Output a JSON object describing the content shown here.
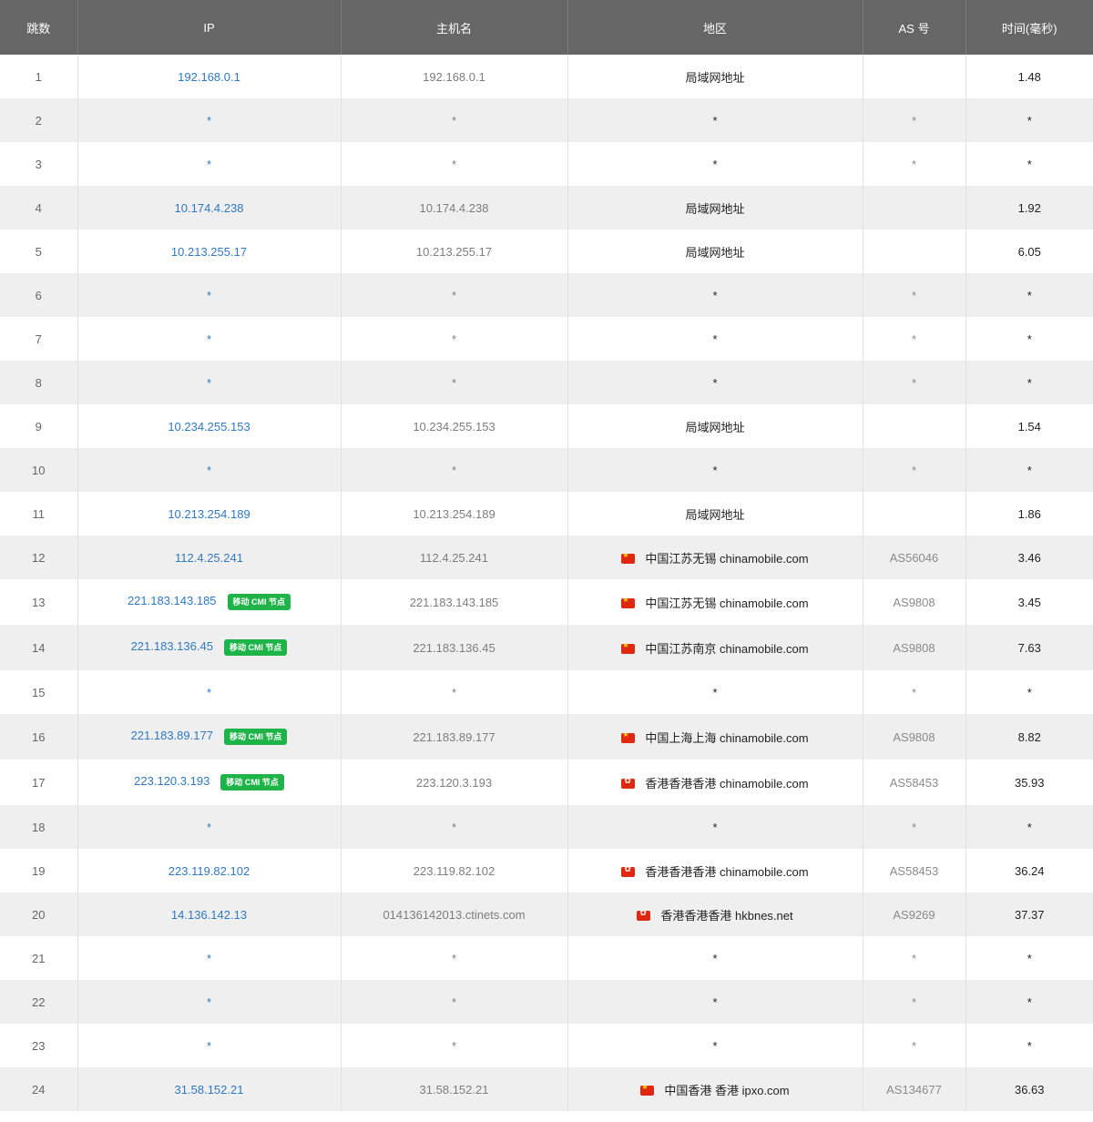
{
  "headers": {
    "hop": "跳数",
    "ip": "IP",
    "host": "主机名",
    "region": "地区",
    "as": "AS 号",
    "time": "时间(毫秒)"
  },
  "colors": {
    "header_bg": "#666666",
    "ip_link": "#2f79c4",
    "badge_bg": "#1fb44a",
    "row_alt": "#efefef"
  },
  "rows": [
    {
      "hop": "1",
      "ip": "192.168.0.1",
      "host": "192.168.0.1",
      "region": "局域网地址",
      "as": "",
      "time": "1.48",
      "flag": "",
      "badge": ""
    },
    {
      "hop": "2",
      "ip": "*",
      "host": "*",
      "region": "*",
      "as": "*",
      "time": "*",
      "flag": "",
      "badge": ""
    },
    {
      "hop": "3",
      "ip": "*",
      "host": "*",
      "region": "*",
      "as": "*",
      "time": "*",
      "flag": "",
      "badge": ""
    },
    {
      "hop": "4",
      "ip": "10.174.4.238",
      "host": "10.174.4.238",
      "region": "局域网地址",
      "as": "",
      "time": "1.92",
      "flag": "",
      "badge": ""
    },
    {
      "hop": "5",
      "ip": "10.213.255.17",
      "host": "10.213.255.17",
      "region": "局域网地址",
      "as": "",
      "time": "6.05",
      "flag": "",
      "badge": ""
    },
    {
      "hop": "6",
      "ip": "*",
      "host": "*",
      "region": "*",
      "as": "*",
      "time": "*",
      "flag": "",
      "badge": ""
    },
    {
      "hop": "7",
      "ip": "*",
      "host": "*",
      "region": "*",
      "as": "*",
      "time": "*",
      "flag": "",
      "badge": ""
    },
    {
      "hop": "8",
      "ip": "*",
      "host": "*",
      "region": "*",
      "as": "*",
      "time": "*",
      "flag": "",
      "badge": ""
    },
    {
      "hop": "9",
      "ip": "10.234.255.153",
      "host": "10.234.255.153",
      "region": "局域网地址",
      "as": "",
      "time": "1.54",
      "flag": "",
      "badge": ""
    },
    {
      "hop": "10",
      "ip": "*",
      "host": "*",
      "region": "*",
      "as": "*",
      "time": "*",
      "flag": "",
      "badge": ""
    },
    {
      "hop": "11",
      "ip": "10.213.254.189",
      "host": "10.213.254.189",
      "region": "局域网地址",
      "as": "",
      "time": "1.86",
      "flag": "",
      "badge": ""
    },
    {
      "hop": "12",
      "ip": "112.4.25.241",
      "host": "112.4.25.241",
      "region": "中国江苏无锡 chinamobile.com",
      "as": "AS56046",
      "time": "3.46",
      "flag": "cn",
      "badge": ""
    },
    {
      "hop": "13",
      "ip": "221.183.143.185",
      "host": "221.183.143.185",
      "region": "中国江苏无锡 chinamobile.com",
      "as": "AS9808",
      "time": "3.45",
      "flag": "cn",
      "badge": "移动 CMI 节点"
    },
    {
      "hop": "14",
      "ip": "221.183.136.45",
      "host": "221.183.136.45",
      "region": "中国江苏南京 chinamobile.com",
      "as": "AS9808",
      "time": "7.63",
      "flag": "cn",
      "badge": "移动 CMI 节点"
    },
    {
      "hop": "15",
      "ip": "*",
      "host": "*",
      "region": "*",
      "as": "*",
      "time": "*",
      "flag": "",
      "badge": ""
    },
    {
      "hop": "16",
      "ip": "221.183.89.177",
      "host": "221.183.89.177",
      "region": "中国上海上海 chinamobile.com",
      "as": "AS9808",
      "time": "8.82",
      "flag": "cn",
      "badge": "移动 CMI 节点"
    },
    {
      "hop": "17",
      "ip": "223.120.3.193",
      "host": "223.120.3.193",
      "region": "香港香港香港 chinamobile.com",
      "as": "AS58453",
      "time": "35.93",
      "flag": "hk",
      "badge": "移动 CMI 节点"
    },
    {
      "hop": "18",
      "ip": "*",
      "host": "*",
      "region": "*",
      "as": "*",
      "time": "*",
      "flag": "",
      "badge": ""
    },
    {
      "hop": "19",
      "ip": "223.119.82.102",
      "host": "223.119.82.102",
      "region": "香港香港香港 chinamobile.com",
      "as": "AS58453",
      "time": "36.24",
      "flag": "hk",
      "badge": ""
    },
    {
      "hop": "20",
      "ip": "14.136.142.13",
      "host": "014136142013.ctinets.com",
      "region": "香港香港香港 hkbnes.net",
      "as": "AS9269",
      "time": "37.37",
      "flag": "hk",
      "badge": ""
    },
    {
      "hop": "21",
      "ip": "*",
      "host": "*",
      "region": "*",
      "as": "*",
      "time": "*",
      "flag": "",
      "badge": ""
    },
    {
      "hop": "22",
      "ip": "*",
      "host": "*",
      "region": "*",
      "as": "*",
      "time": "*",
      "flag": "",
      "badge": ""
    },
    {
      "hop": "23",
      "ip": "*",
      "host": "*",
      "region": "*",
      "as": "*",
      "time": "*",
      "flag": "",
      "badge": ""
    },
    {
      "hop": "24",
      "ip": "31.58.152.21",
      "host": "31.58.152.21",
      "region": "中国香港 香港 ipxo.com",
      "as": "AS134677",
      "time": "36.63",
      "flag": "cn",
      "badge": ""
    }
  ]
}
